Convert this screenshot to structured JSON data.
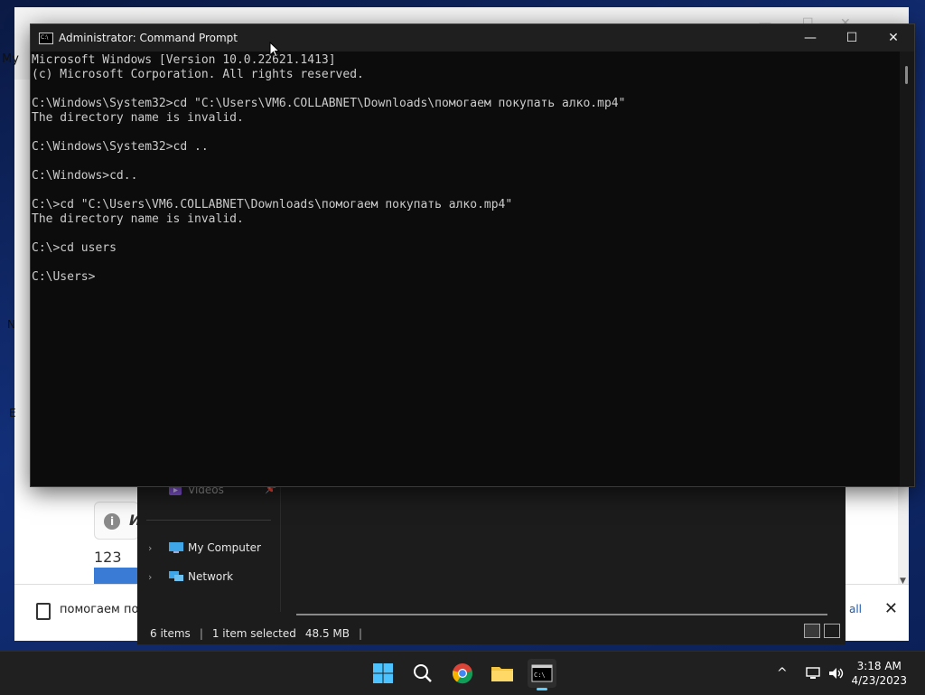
{
  "background_browser": {
    "left_letters": [
      "My",
      "N",
      "E"
    ],
    "info_text": "И",
    "number": "123",
    "download_bar": {
      "file_name": "помогаем пок",
      "show_all": "v all",
      "close": "✕"
    }
  },
  "explorer": {
    "nav": {
      "videos": "Videos",
      "my_computer": "My Computer",
      "network": "Network"
    },
    "status": {
      "items": "6 items",
      "selected": "1 item selected",
      "size": "48.5 MB",
      "sep": "|"
    }
  },
  "cmd": {
    "title": "Administrator: Command Prompt",
    "lines": [
      "Microsoft Windows [Version 10.0.22621.1413]",
      "(c) Microsoft Corporation. All rights reserved.",
      "",
      "C:\\Windows\\System32>cd \"C:\\Users\\VM6.COLLABNET\\Downloads\\помогаем покупать алко.mp4\"",
      "The directory name is invalid.",
      "",
      "C:\\Windows\\System32>cd ..",
      "",
      "C:\\Windows>cd..",
      "",
      "C:\\>cd \"C:\\Users\\VM6.COLLABNET\\Downloads\\помогаем покупать алко.mp4\"",
      "The directory name is invalid.",
      "",
      "C:\\>cd users",
      "",
      "C:\\Users>"
    ],
    "controls": {
      "minimize": "—",
      "maximize": "☐",
      "close": "✕"
    }
  },
  "taskbar": {
    "apps": [
      "start-icon",
      "search-icon",
      "chrome-icon",
      "file-explorer-icon",
      "terminal-icon"
    ],
    "tray": {
      "chevron": "^"
    },
    "clock": {
      "time": "3:18 AM",
      "date": "4/23/2023"
    }
  }
}
